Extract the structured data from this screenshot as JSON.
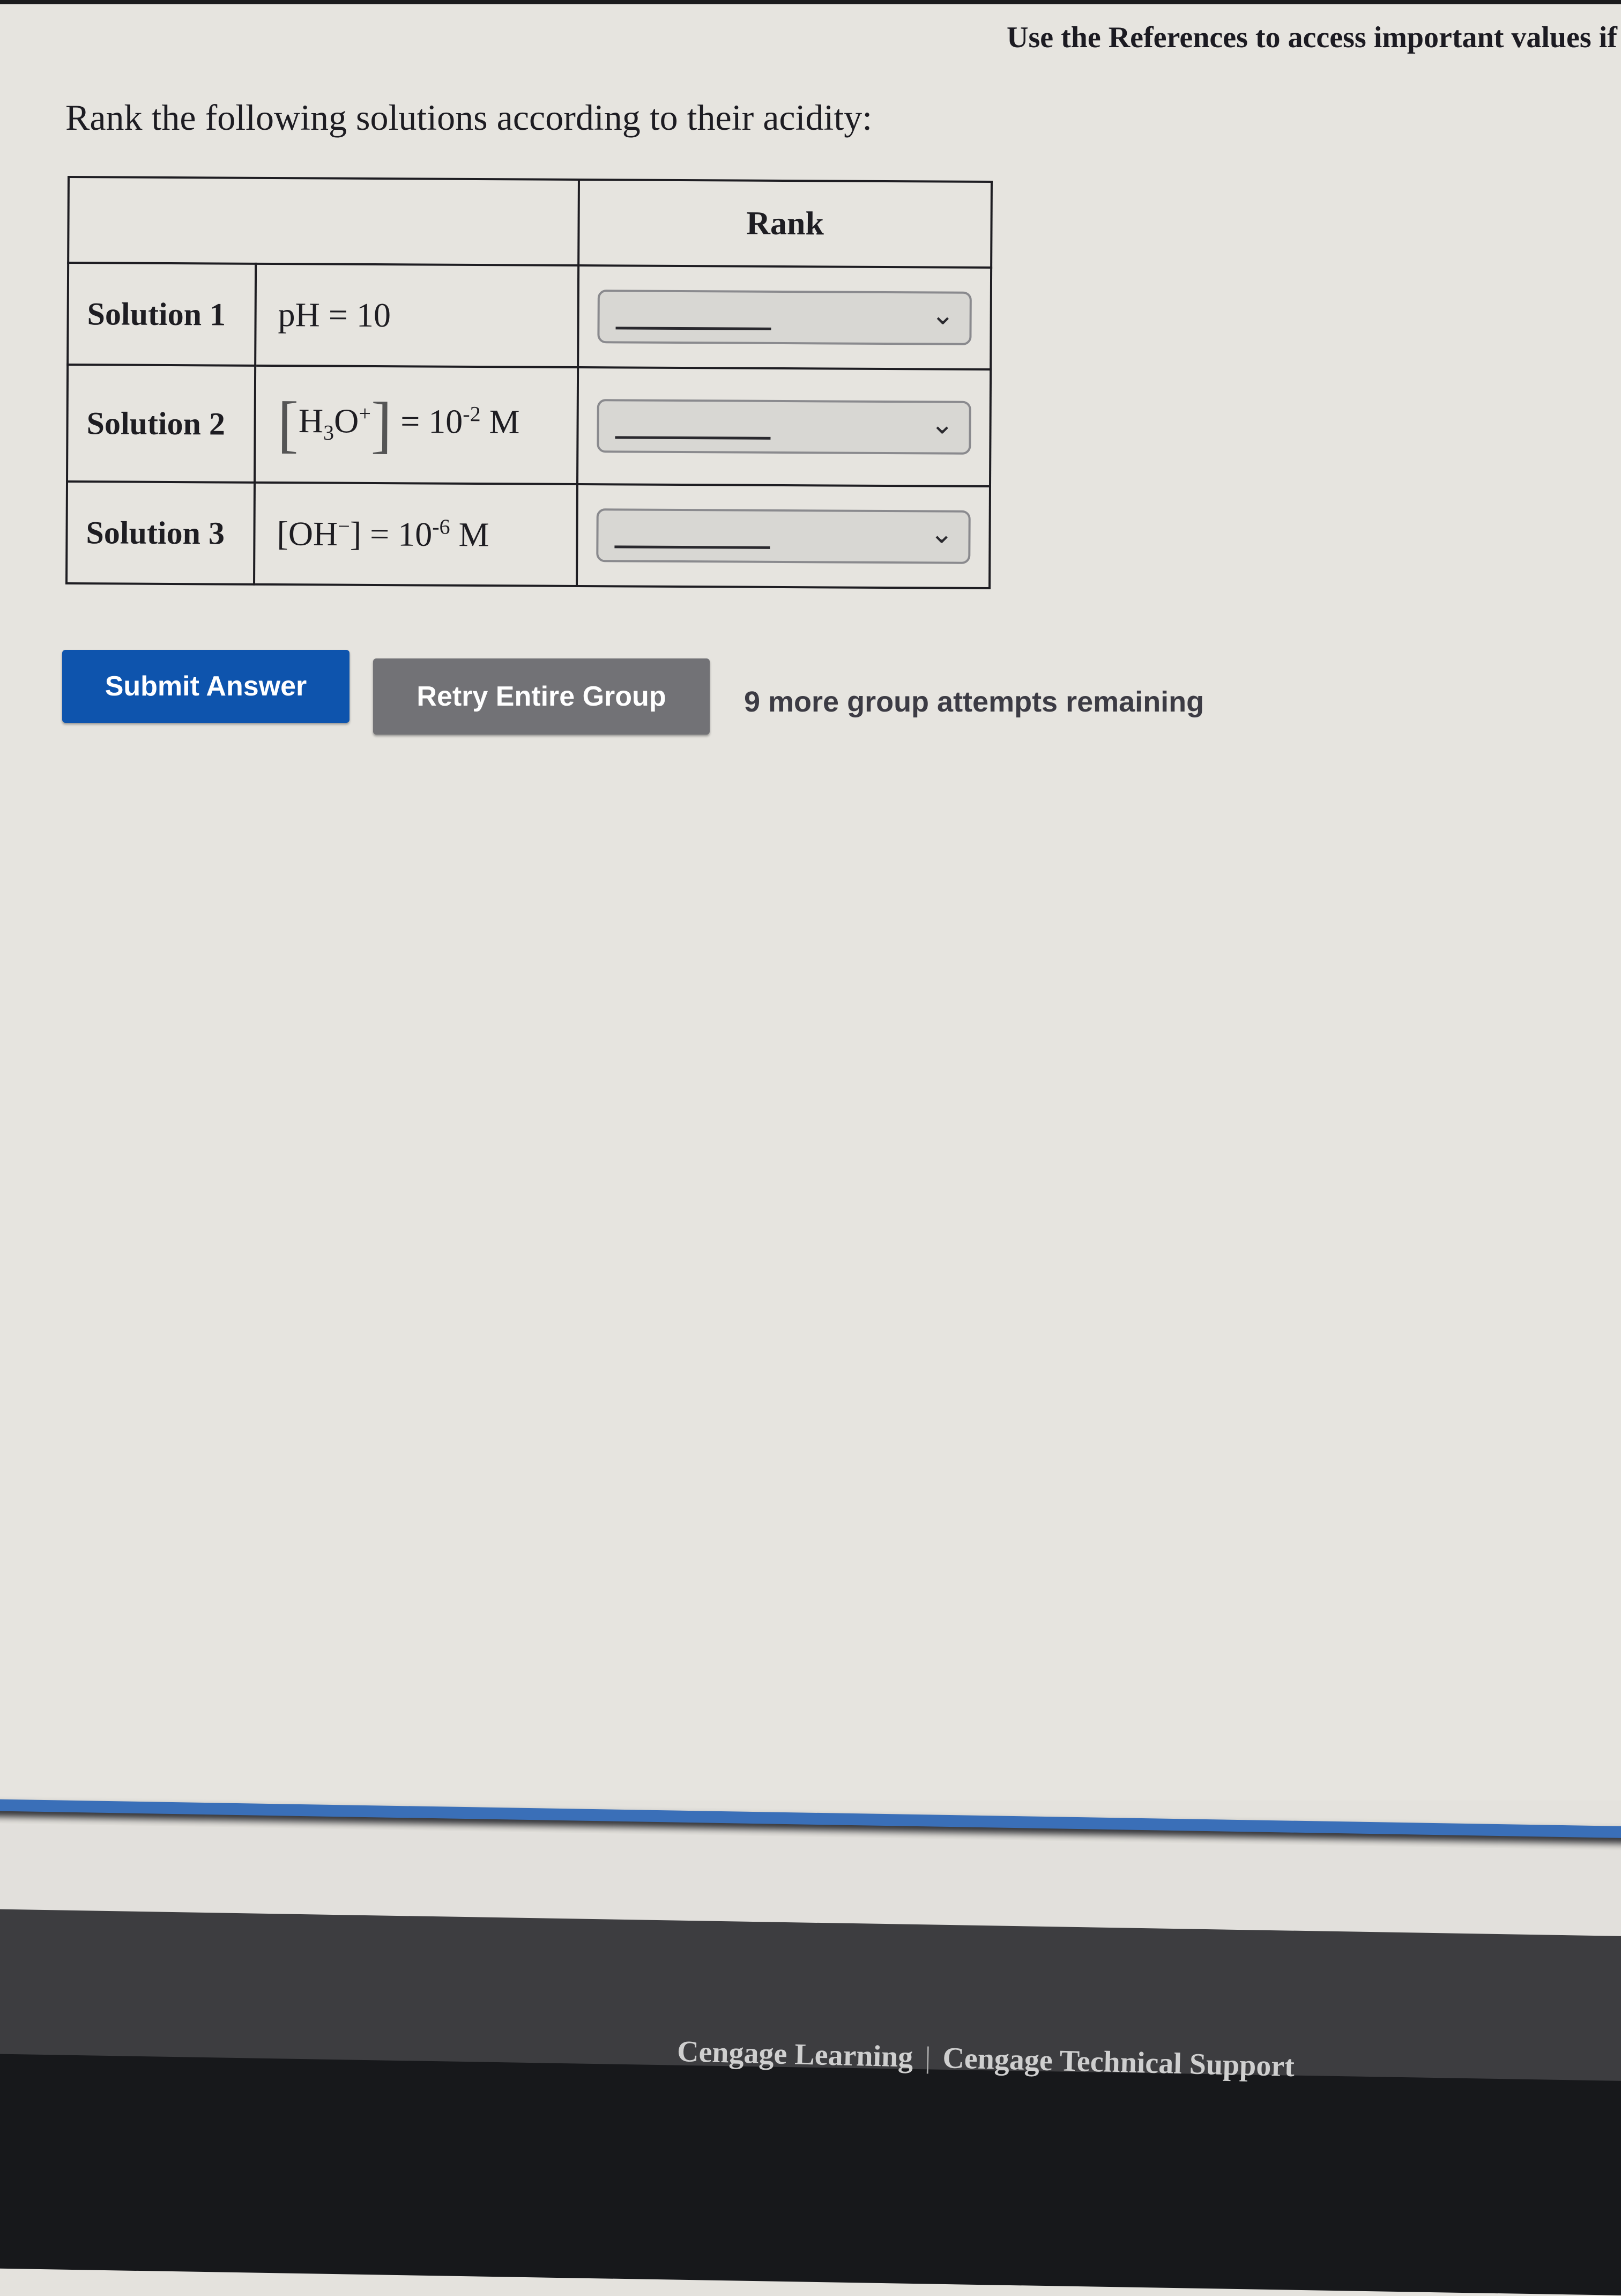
{
  "header": {
    "references_text": "Use the References to access important values if"
  },
  "question": {
    "prompt": "Rank the following solutions according to their acidity:"
  },
  "table": {
    "rank_header": "Rank",
    "rows": [
      {
        "label": "Solution 1",
        "formula": {
          "base": "pH = 10"
        },
        "rank_select": {
          "selected": "",
          "placeholder_blank": true
        }
      },
      {
        "label": "Solution 2",
        "formula": {
          "species": "H",
          "species_sub": "3",
          "species2": "O",
          "charge": "+",
          "equals": "= 10",
          "exponent": "-2",
          "unit": "M"
        },
        "rank_select": {
          "selected": "",
          "placeholder_blank": true
        }
      },
      {
        "label": "Solution 3",
        "formula": {
          "species": "OH",
          "charge": "−",
          "equals": "= 10",
          "exponent": "-6",
          "unit": "M"
        },
        "rank_select": {
          "selected": "",
          "placeholder_blank": true
        }
      }
    ]
  },
  "actions": {
    "submit_label": "Submit Answer",
    "retry_label": "Retry Entire Group",
    "attempts_text": "9 more group attempts remaining"
  },
  "footer": {
    "link1": "Cengage Learning",
    "separator": "|",
    "link2": "Cengage Technical Support"
  },
  "colors": {
    "submit_bg": "#0e54ad",
    "retry_bg": "#727276",
    "accent_line": "#3a6fb8",
    "footer_bg": "#3d3d40"
  },
  "icons": {
    "dropdown": "chevron-down-icon"
  }
}
